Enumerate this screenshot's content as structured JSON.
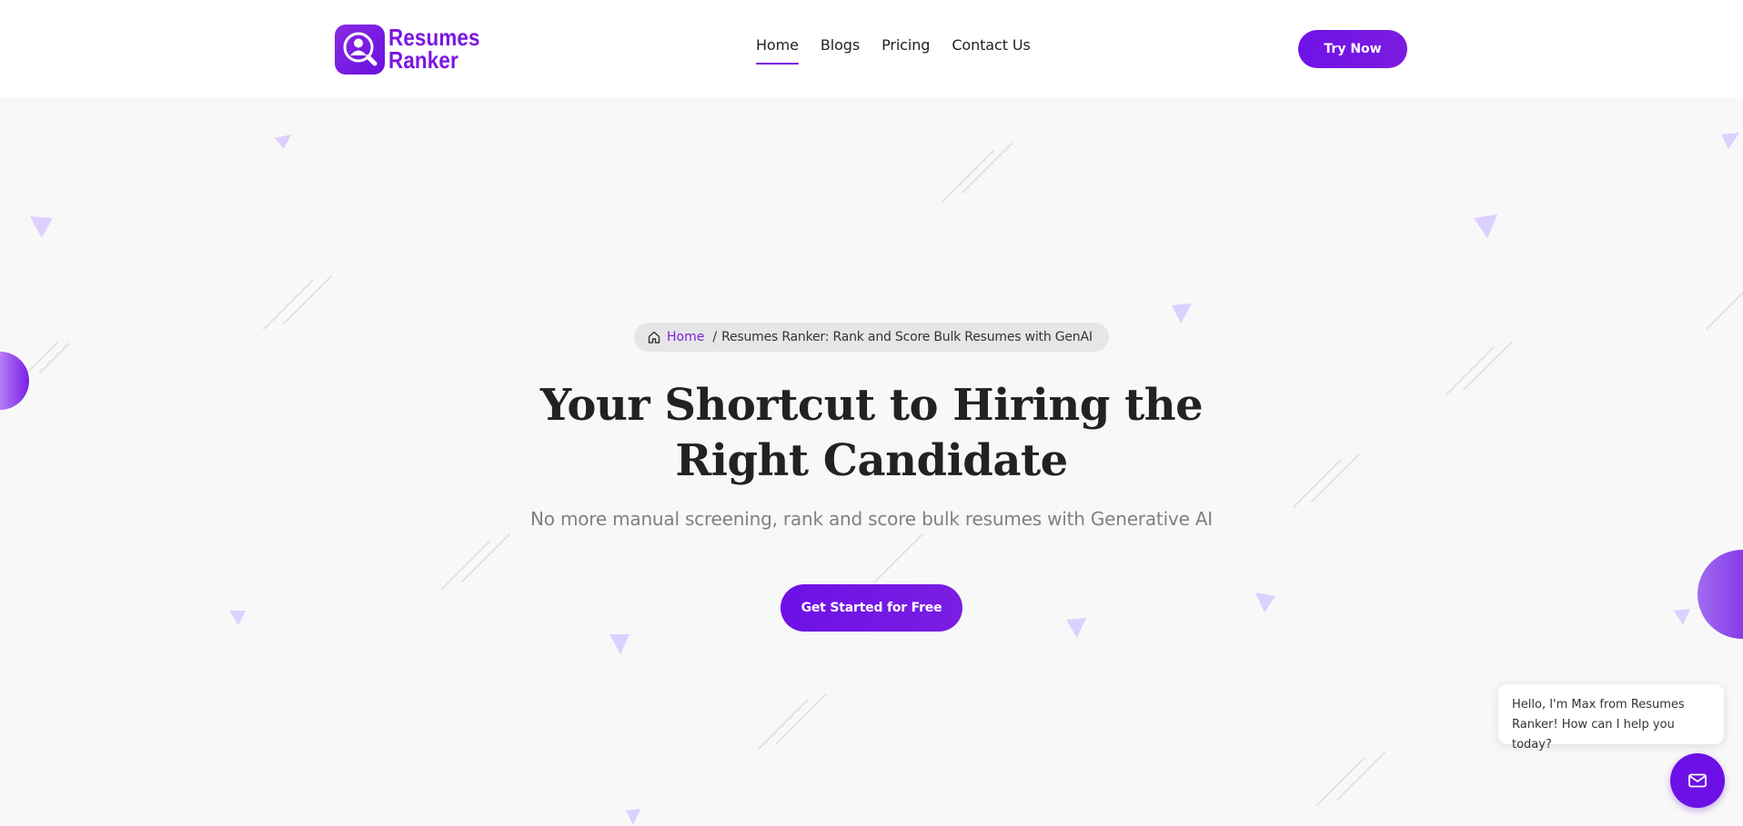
{
  "header": {
    "logo_line1": "Resumes",
    "logo_line2": "Ranker",
    "nav": [
      {
        "label": "Home",
        "active": true
      },
      {
        "label": "Blogs",
        "active": false
      },
      {
        "label": "Pricing",
        "active": false
      },
      {
        "label": "Contact Us",
        "active": false
      }
    ],
    "cta_label": "Try Now"
  },
  "breadcrumb": {
    "home_label": "Home",
    "separator": "/",
    "current": "Resumes Ranker: Rank and Score Bulk Resumes with GenAI"
  },
  "hero": {
    "title_line1": "Your Shortcut to Hiring the",
    "title_line2": "Right Candidate",
    "subtitle": "No more manual screening, rank and score bulk resumes with Generative AI",
    "cta_label": "Get Started for Free"
  },
  "chat": {
    "message_line1": "Hello, I'm Max from Resumes",
    "message_line2": "Ranker! How can I help you today?",
    "button_icon": "mail-icon"
  },
  "colors": {
    "brand": "#6d10e6",
    "background": "#f8f8f9",
    "deco_triangle": "#d9ccff"
  },
  "icons": [
    "user-search-icon",
    "home-icon",
    "mail-icon"
  ]
}
